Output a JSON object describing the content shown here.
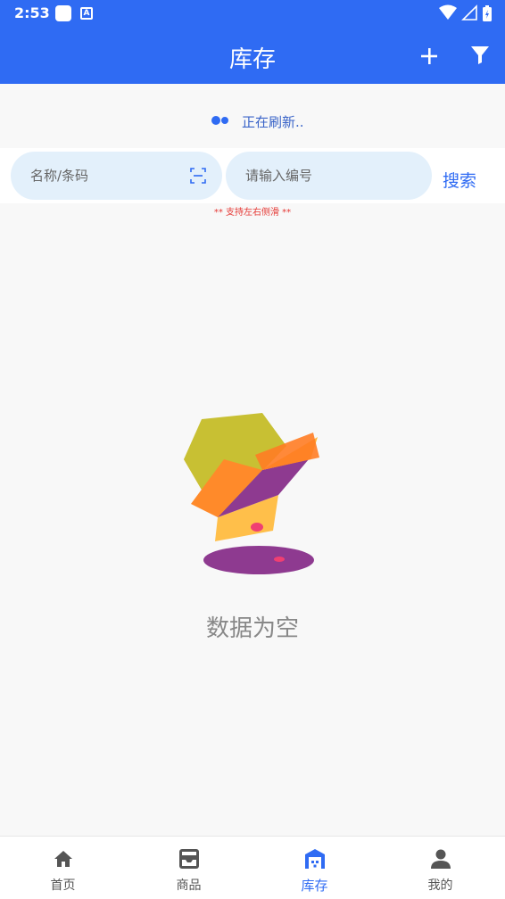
{
  "status_bar": {
    "time": "2:53"
  },
  "app_bar": {
    "title": "库存"
  },
  "refresh": {
    "text": "正在刷新.."
  },
  "search": {
    "name_placeholder": "名称/条码",
    "code_placeholder": "请输入编号",
    "button_label": "搜索"
  },
  "hint": "** 支持左右侧滑 **",
  "empty": {
    "text": "数据为空"
  },
  "bottom_nav": {
    "items": [
      {
        "label": "首页",
        "icon": "home-icon"
      },
      {
        "label": "商品",
        "icon": "inbox-icon"
      },
      {
        "label": "库存",
        "icon": "warehouse-icon"
      },
      {
        "label": "我的",
        "icon": "person-icon"
      }
    ],
    "active_index": 2
  },
  "colors": {
    "primary": "#2f6bf3",
    "pill": "#e3f0fb",
    "hint": "#e53935",
    "muted_text": "#888888"
  }
}
